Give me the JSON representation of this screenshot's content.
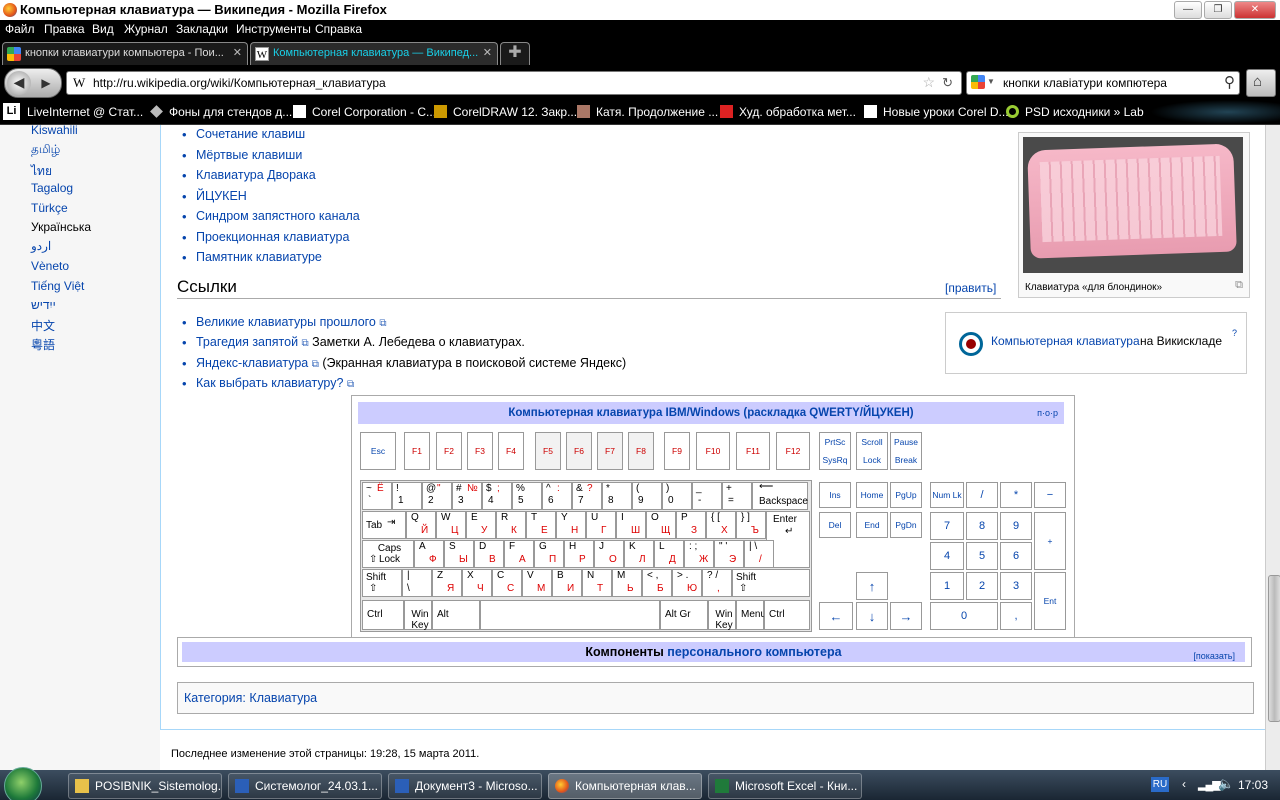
{
  "window": {
    "title": "Компьютерная клавиатура — Википедия - Mozilla Firefox"
  },
  "menu": [
    "Файл",
    "Правка",
    "Вид",
    "Журнал",
    "Закладки",
    "Инструменты",
    "Справка"
  ],
  "tabs": [
    {
      "label": "кнопки клавиатури компьютера - Пои...",
      "active": false
    },
    {
      "label": "Компьютерная клавиатура — Википед...",
      "active": true
    }
  ],
  "nav": {
    "url": "http://ru.wikipedia.org/wiki/Компьютерная_клавиатура",
    "search": "кнопки клавіатури компютера"
  },
  "bookmarks": [
    "LiveInternet @ Стат...",
    "Фоны для стендов д...",
    "Corel Corporation - C...",
    "CorelDRAW 12. Закр...",
    "Катя. Продолжение ...",
    "Худ. обработка мет...",
    "Новые уроки Corel D...",
    "PSD исходники » Lab"
  ],
  "languages": [
    "Kiswahili",
    "தமிழ்",
    "ไทย",
    "Tagalog",
    "Türkçe",
    "Українська",
    "اردو",
    "Vèneto",
    "Tiếng Việt",
    "ייִדיש",
    "中文",
    "粵語"
  ],
  "see_also": [
    "Сочетание клавиш",
    "Мёртвые клавиши",
    "Клавиатура Дворака",
    "ЙЦУКЕН",
    "Синдром запястного канала",
    "Проекционная клавиатура",
    "Памятник клавиатуре"
  ],
  "links_section": {
    "title": "Ссылки",
    "edit": "[править]",
    "items": [
      {
        "link": "Великие клавиатуры прошлого",
        "text": ""
      },
      {
        "link": "Трагедия запятой",
        "text": " Заметки А. Лебедева о клавиатурах."
      },
      {
        "link": "Яндекс-клавиатура",
        "text": " (Экранная клавиатура в поисковой системе Яндекс)"
      },
      {
        "link": "Как выбрать клавиатуру?",
        "text": ""
      }
    ]
  },
  "thumb": {
    "caption": "Клавиатура «для блондинок»"
  },
  "commons": {
    "link": "Компьютерная клавиатура",
    "text": " на Викискладе",
    "sup": "?"
  },
  "keyboard_box": {
    "title": "Компьютерная клавиатура IBM/Windows",
    "title_paren": "(раскладка QWERTY/ЙЦУКЕН)",
    "vde": "п·о·р",
    "keys": {
      "esc": "Esc",
      "f": [
        "F1",
        "F2",
        "F3",
        "F4",
        "F5",
        "F6",
        "F7",
        "F8",
        "F9",
        "F10",
        "F11",
        "F12"
      ],
      "prtsc": "PrtSc",
      "sysrq": "SysRq",
      "scroll": "Scroll",
      "lock": "Lock",
      "pause": "Pause",
      "brk": "Break",
      "backspace": "Backspace",
      "tab": "Tab",
      "enter": "Enter",
      "caps": "Caps Lock",
      "shift": "Shift",
      "ctrl": "Ctrl",
      "winkey": "Win Key",
      "alt": "Alt",
      "altgr": "Alt Gr",
      "menu": "Menu",
      "ins": "Ins",
      "home": "Home",
      "pgup": "PgUp",
      "del": "Del",
      "end": "End",
      "pgdn": "PgDn",
      "numlk": "Num Lk",
      "slash": "/",
      "star": "*",
      "minus": "−",
      "plus": "+",
      "n7": "7",
      "n8": "8",
      "n9": "9",
      "n4": "4",
      "n5": "5",
      "n6": "6",
      "n1": "1",
      "n2": "2",
      "n3": "3",
      "n0": "0",
      "ndot": ",",
      "nent": "Ent"
    },
    "row1": [
      [
        "~",
        "`",
        "Ё",
        ""
      ],
      [
        "!",
        "1",
        "",
        ""
      ],
      [
        "@",
        "2",
        "\"",
        ""
      ],
      [
        "#",
        "3",
        "№",
        ""
      ],
      [
        "$",
        "4",
        ";",
        ""
      ],
      [
        "%",
        "5",
        "",
        ""
      ],
      [
        "^",
        "6",
        ":",
        ""
      ],
      [
        "&",
        "7",
        "?",
        ""
      ],
      [
        "*",
        "8",
        "",
        ""
      ],
      [
        "(",
        "9",
        "",
        ""
      ],
      [
        ")",
        "0",
        "",
        ""
      ],
      [
        "_",
        "-",
        "",
        ""
      ],
      [
        "+",
        "=",
        "",
        ""
      ]
    ],
    "row2": [
      [
        "Q",
        "Й"
      ],
      [
        "W",
        "Ц"
      ],
      [
        "E",
        "У"
      ],
      [
        "R",
        "К"
      ],
      [
        "T",
        "Е"
      ],
      [
        "Y",
        "Н"
      ],
      [
        "U",
        "Г"
      ],
      [
        "I",
        "Ш"
      ],
      [
        "O",
        "Щ"
      ],
      [
        "P",
        "З"
      ],
      [
        "{ [",
        "Х"
      ],
      [
        "} ]",
        "Ъ"
      ]
    ],
    "row3": [
      [
        "A",
        "Ф"
      ],
      [
        "S",
        "Ы"
      ],
      [
        "D",
        "В"
      ],
      [
        "F",
        "А"
      ],
      [
        "G",
        "П"
      ],
      [
        "H",
        "Р"
      ],
      [
        "J",
        "О"
      ],
      [
        "K",
        "Л"
      ],
      [
        "L",
        "Д"
      ],
      [
        ": ;",
        "Ж"
      ],
      [
        "\" '",
        "Э"
      ],
      [
        "| \\",
        "/"
      ]
    ],
    "row4": [
      [
        "Z",
        "Я"
      ],
      [
        "X",
        "Ч"
      ],
      [
        "C",
        "С"
      ],
      [
        "V",
        "М"
      ],
      [
        "B",
        "И"
      ],
      [
        "N",
        "Т"
      ],
      [
        "M",
        "Ь"
      ],
      [
        "< ,",
        "Б"
      ],
      [
        "> .",
        "Ю"
      ],
      [
        "? /",
        ","
      ]
    ]
  },
  "components": {
    "prefix": "Компоненты",
    "link": "персонального компьютера",
    "show": "[показать]"
  },
  "category": {
    "label": "Категория:",
    "value": "Клавиатура"
  },
  "footer": "Последнее изменение этой страницы: 19:28, 15 марта 2011.",
  "taskbar": {
    "items": [
      {
        "label": "POSIBNIK_Sistemolog...",
        "active": false
      },
      {
        "label": "Системолог_24.03.1...",
        "active": false
      },
      {
        "label": "Документ3 - Microso...",
        "active": false
      },
      {
        "label": "Компьютерная клав...",
        "active": true
      },
      {
        "label": "Microsoft Excel - Кни...",
        "active": false
      }
    ],
    "lang": "RU",
    "clock": "17:03"
  }
}
